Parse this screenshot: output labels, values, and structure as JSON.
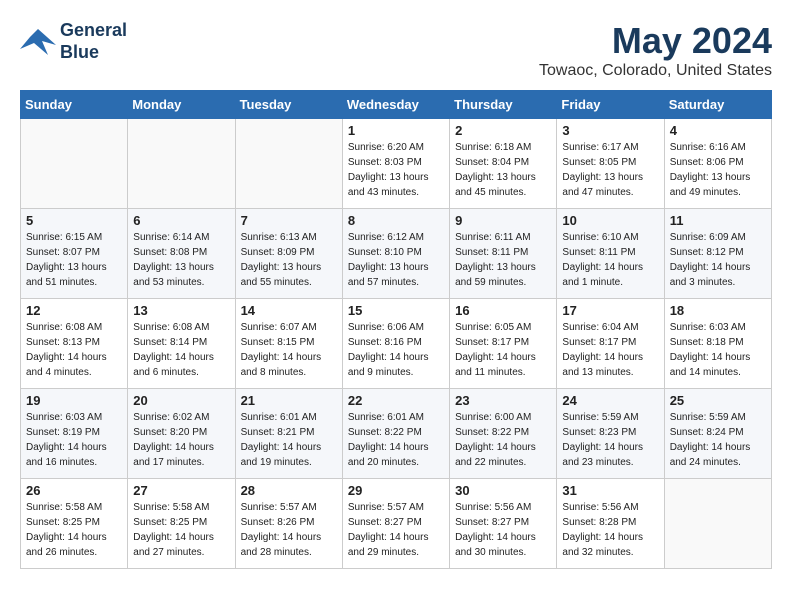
{
  "logo": {
    "line1": "General",
    "line2": "Blue"
  },
  "title": "May 2024",
  "subtitle": "Towaoc, Colorado, United States",
  "days_of_week": [
    "Sunday",
    "Monday",
    "Tuesday",
    "Wednesday",
    "Thursday",
    "Friday",
    "Saturday"
  ],
  "weeks": [
    [
      {
        "day": "",
        "info": ""
      },
      {
        "day": "",
        "info": ""
      },
      {
        "day": "",
        "info": ""
      },
      {
        "day": "1",
        "info": "Sunrise: 6:20 AM\nSunset: 8:03 PM\nDaylight: 13 hours\nand 43 minutes."
      },
      {
        "day": "2",
        "info": "Sunrise: 6:18 AM\nSunset: 8:04 PM\nDaylight: 13 hours\nand 45 minutes."
      },
      {
        "day": "3",
        "info": "Sunrise: 6:17 AM\nSunset: 8:05 PM\nDaylight: 13 hours\nand 47 minutes."
      },
      {
        "day": "4",
        "info": "Sunrise: 6:16 AM\nSunset: 8:06 PM\nDaylight: 13 hours\nand 49 minutes."
      }
    ],
    [
      {
        "day": "5",
        "info": "Sunrise: 6:15 AM\nSunset: 8:07 PM\nDaylight: 13 hours\nand 51 minutes."
      },
      {
        "day": "6",
        "info": "Sunrise: 6:14 AM\nSunset: 8:08 PM\nDaylight: 13 hours\nand 53 minutes."
      },
      {
        "day": "7",
        "info": "Sunrise: 6:13 AM\nSunset: 8:09 PM\nDaylight: 13 hours\nand 55 minutes."
      },
      {
        "day": "8",
        "info": "Sunrise: 6:12 AM\nSunset: 8:10 PM\nDaylight: 13 hours\nand 57 minutes."
      },
      {
        "day": "9",
        "info": "Sunrise: 6:11 AM\nSunset: 8:11 PM\nDaylight: 13 hours\nand 59 minutes."
      },
      {
        "day": "10",
        "info": "Sunrise: 6:10 AM\nSunset: 8:11 PM\nDaylight: 14 hours\nand 1 minute."
      },
      {
        "day": "11",
        "info": "Sunrise: 6:09 AM\nSunset: 8:12 PM\nDaylight: 14 hours\nand 3 minutes."
      }
    ],
    [
      {
        "day": "12",
        "info": "Sunrise: 6:08 AM\nSunset: 8:13 PM\nDaylight: 14 hours\nand 4 minutes."
      },
      {
        "day": "13",
        "info": "Sunrise: 6:08 AM\nSunset: 8:14 PM\nDaylight: 14 hours\nand 6 minutes."
      },
      {
        "day": "14",
        "info": "Sunrise: 6:07 AM\nSunset: 8:15 PM\nDaylight: 14 hours\nand 8 minutes."
      },
      {
        "day": "15",
        "info": "Sunrise: 6:06 AM\nSunset: 8:16 PM\nDaylight: 14 hours\nand 9 minutes."
      },
      {
        "day": "16",
        "info": "Sunrise: 6:05 AM\nSunset: 8:17 PM\nDaylight: 14 hours\nand 11 minutes."
      },
      {
        "day": "17",
        "info": "Sunrise: 6:04 AM\nSunset: 8:17 PM\nDaylight: 14 hours\nand 13 minutes."
      },
      {
        "day": "18",
        "info": "Sunrise: 6:03 AM\nSunset: 8:18 PM\nDaylight: 14 hours\nand 14 minutes."
      }
    ],
    [
      {
        "day": "19",
        "info": "Sunrise: 6:03 AM\nSunset: 8:19 PM\nDaylight: 14 hours\nand 16 minutes."
      },
      {
        "day": "20",
        "info": "Sunrise: 6:02 AM\nSunset: 8:20 PM\nDaylight: 14 hours\nand 17 minutes."
      },
      {
        "day": "21",
        "info": "Sunrise: 6:01 AM\nSunset: 8:21 PM\nDaylight: 14 hours\nand 19 minutes."
      },
      {
        "day": "22",
        "info": "Sunrise: 6:01 AM\nSunset: 8:22 PM\nDaylight: 14 hours\nand 20 minutes."
      },
      {
        "day": "23",
        "info": "Sunrise: 6:00 AM\nSunset: 8:22 PM\nDaylight: 14 hours\nand 22 minutes."
      },
      {
        "day": "24",
        "info": "Sunrise: 5:59 AM\nSunset: 8:23 PM\nDaylight: 14 hours\nand 23 minutes."
      },
      {
        "day": "25",
        "info": "Sunrise: 5:59 AM\nSunset: 8:24 PM\nDaylight: 14 hours\nand 24 minutes."
      }
    ],
    [
      {
        "day": "26",
        "info": "Sunrise: 5:58 AM\nSunset: 8:25 PM\nDaylight: 14 hours\nand 26 minutes."
      },
      {
        "day": "27",
        "info": "Sunrise: 5:58 AM\nSunset: 8:25 PM\nDaylight: 14 hours\nand 27 minutes."
      },
      {
        "day": "28",
        "info": "Sunrise: 5:57 AM\nSunset: 8:26 PM\nDaylight: 14 hours\nand 28 minutes."
      },
      {
        "day": "29",
        "info": "Sunrise: 5:57 AM\nSunset: 8:27 PM\nDaylight: 14 hours\nand 29 minutes."
      },
      {
        "day": "30",
        "info": "Sunrise: 5:56 AM\nSunset: 8:27 PM\nDaylight: 14 hours\nand 30 minutes."
      },
      {
        "day": "31",
        "info": "Sunrise: 5:56 AM\nSunset: 8:28 PM\nDaylight: 14 hours\nand 32 minutes."
      },
      {
        "day": "",
        "info": ""
      }
    ]
  ]
}
